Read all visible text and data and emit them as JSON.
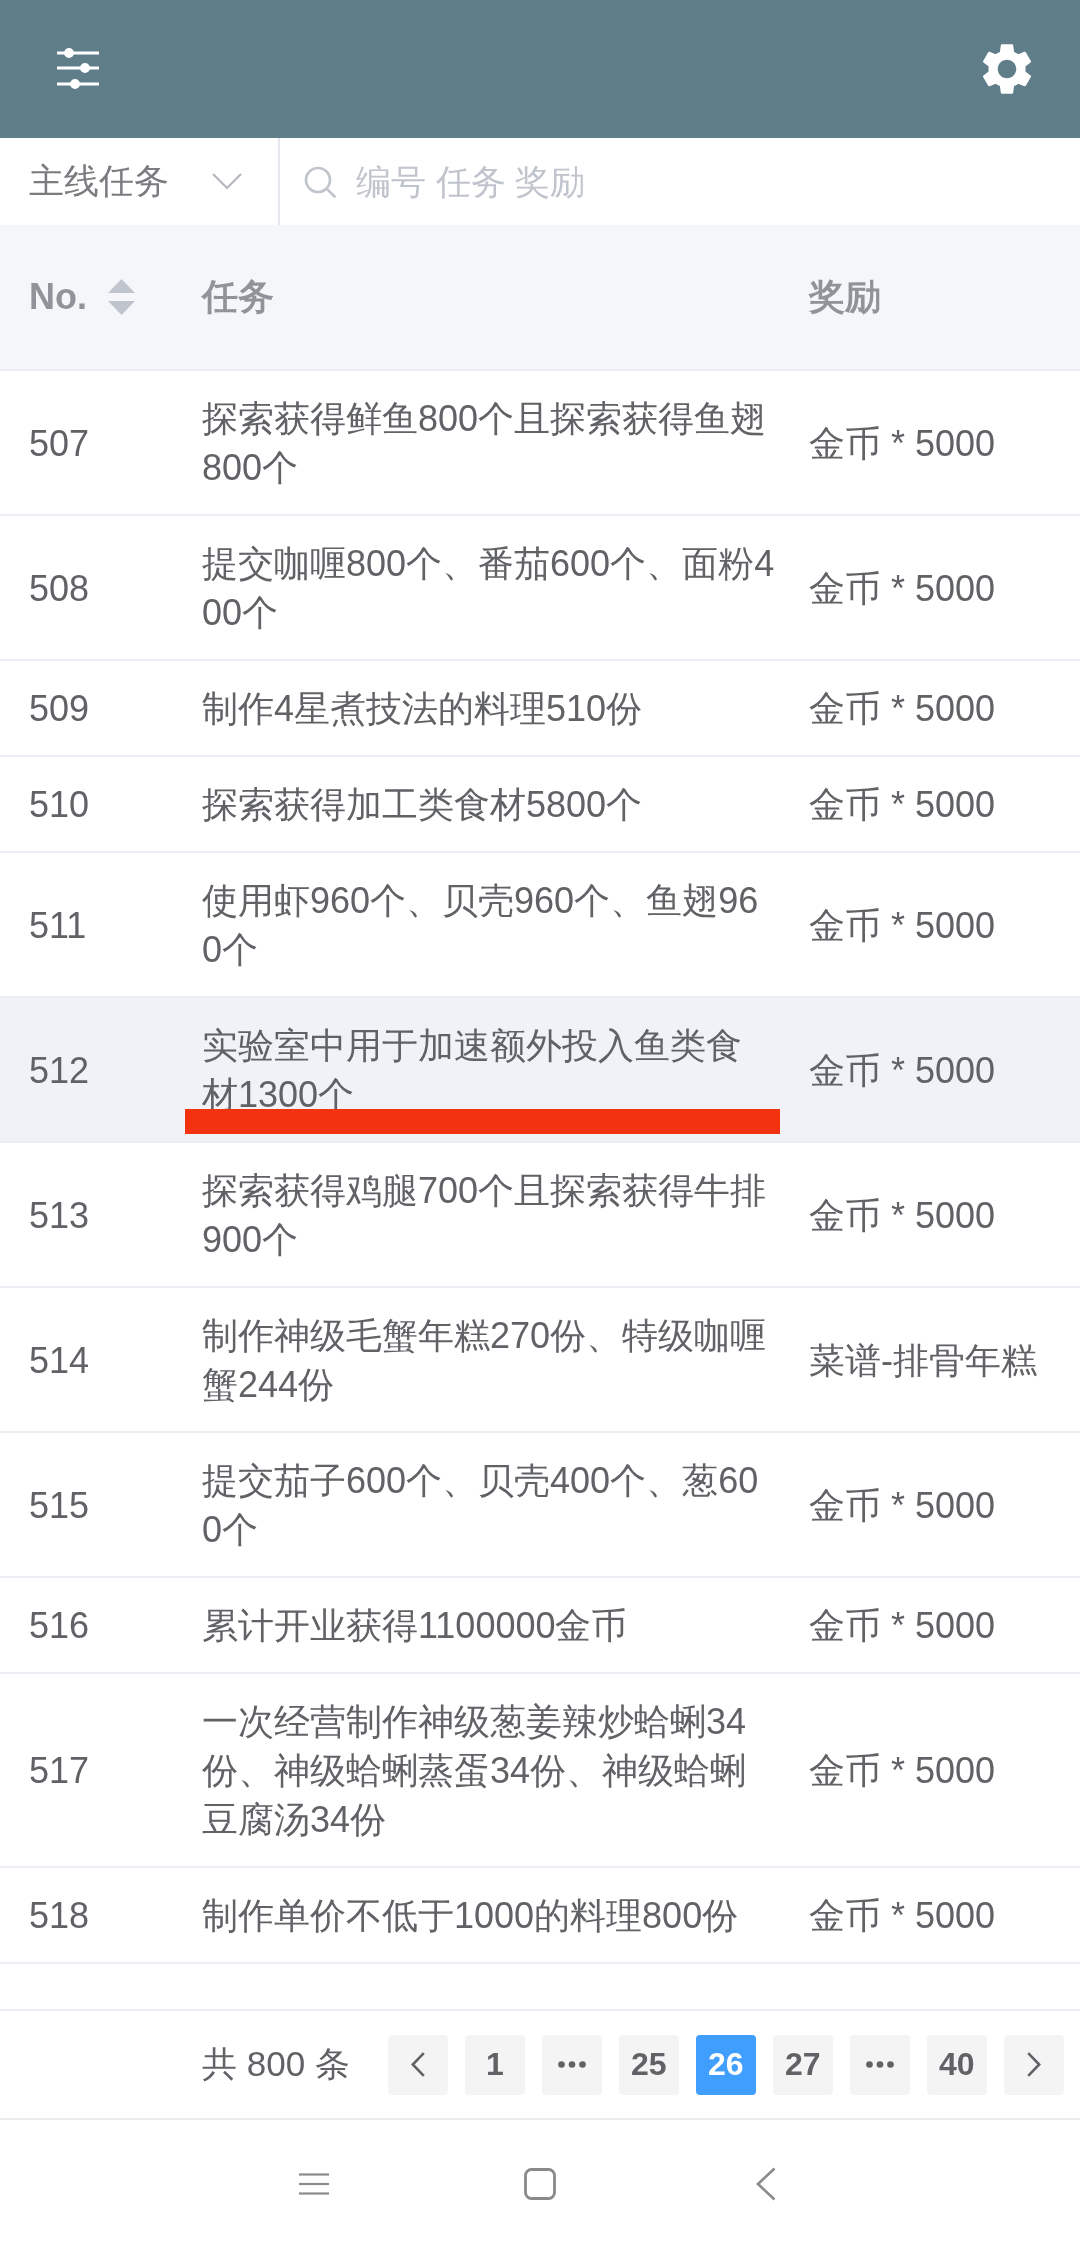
{
  "filter": {
    "category": {
      "value": "主线任务"
    },
    "search": {
      "placeholder": "编号 任务 奖励"
    }
  },
  "table": {
    "columns": [
      {
        "label": "No.",
        "sortable": true
      },
      {
        "label": "任务",
        "sortable": false
      },
      {
        "label": "奖励",
        "sortable": false
      }
    ],
    "rows": [
      {
        "no": "507",
        "task": "探索获得鲜鱼800个且探索获得鱼翅800个",
        "reward": "金币 * 5000",
        "selected": false,
        "marked": false
      },
      {
        "no": "508",
        "task": "提交咖喱800个、番茄600个、面粉400个",
        "reward": "金币 * 5000",
        "selected": false,
        "marked": false
      },
      {
        "no": "509",
        "task": "制作4星煮技法的料理510份",
        "reward": "金币 * 5000",
        "selected": false,
        "marked": false
      },
      {
        "no": "510",
        "task": "探索获得加工类食材5800个",
        "reward": "金币 * 5000",
        "selected": false,
        "marked": false
      },
      {
        "no": "511",
        "task": "使用虾960个、贝壳960个、鱼翅960个",
        "reward": "金币 * 5000",
        "selected": false,
        "marked": false
      },
      {
        "no": "512",
        "task": "实验室中用于加速额外投入鱼类食材1300个",
        "reward": "金币 * 5000",
        "selected": true,
        "marked": true
      },
      {
        "no": "513",
        "task": "探索获得鸡腿700个且探索获得牛排900个",
        "reward": "金币 * 5000",
        "selected": false,
        "marked": false
      },
      {
        "no": "514",
        "task": "制作神级毛蟹年糕270份、特级咖喱蟹244份",
        "reward": "菜谱-排骨年糕",
        "selected": false,
        "marked": false
      },
      {
        "no": "515",
        "task": "提交茄子600个、贝壳400个、葱600个",
        "reward": "金币 * 5000",
        "selected": false,
        "marked": false
      },
      {
        "no": "516",
        "task": "累计开业获得1100000金币",
        "reward": "金币 * 5000",
        "selected": false,
        "marked": false
      },
      {
        "no": "517",
        "task": "一次经营制作神级葱姜辣炒蛤蜊34份、神级蛤蜊蒸蛋34份、神级蛤蜊豆腐汤34份",
        "reward": "金币 * 5000",
        "selected": false,
        "marked": false
      },
      {
        "no": "518",
        "task": "制作单价不低于1000的料理800份",
        "reward": "金币 * 5000",
        "selected": false,
        "marked": false
      }
    ]
  },
  "pagination": {
    "total": "共 800 条",
    "pages": [
      {
        "kind": "page",
        "label": "1",
        "selected": false
      },
      {
        "kind": "more"
      },
      {
        "kind": "page",
        "label": "25",
        "selected": false
      },
      {
        "kind": "page",
        "label": "26",
        "selected": true
      },
      {
        "kind": "page",
        "label": "27",
        "selected": false
      },
      {
        "kind": "more"
      },
      {
        "kind": "page",
        "label": "40",
        "selected": false
      }
    ]
  }
}
